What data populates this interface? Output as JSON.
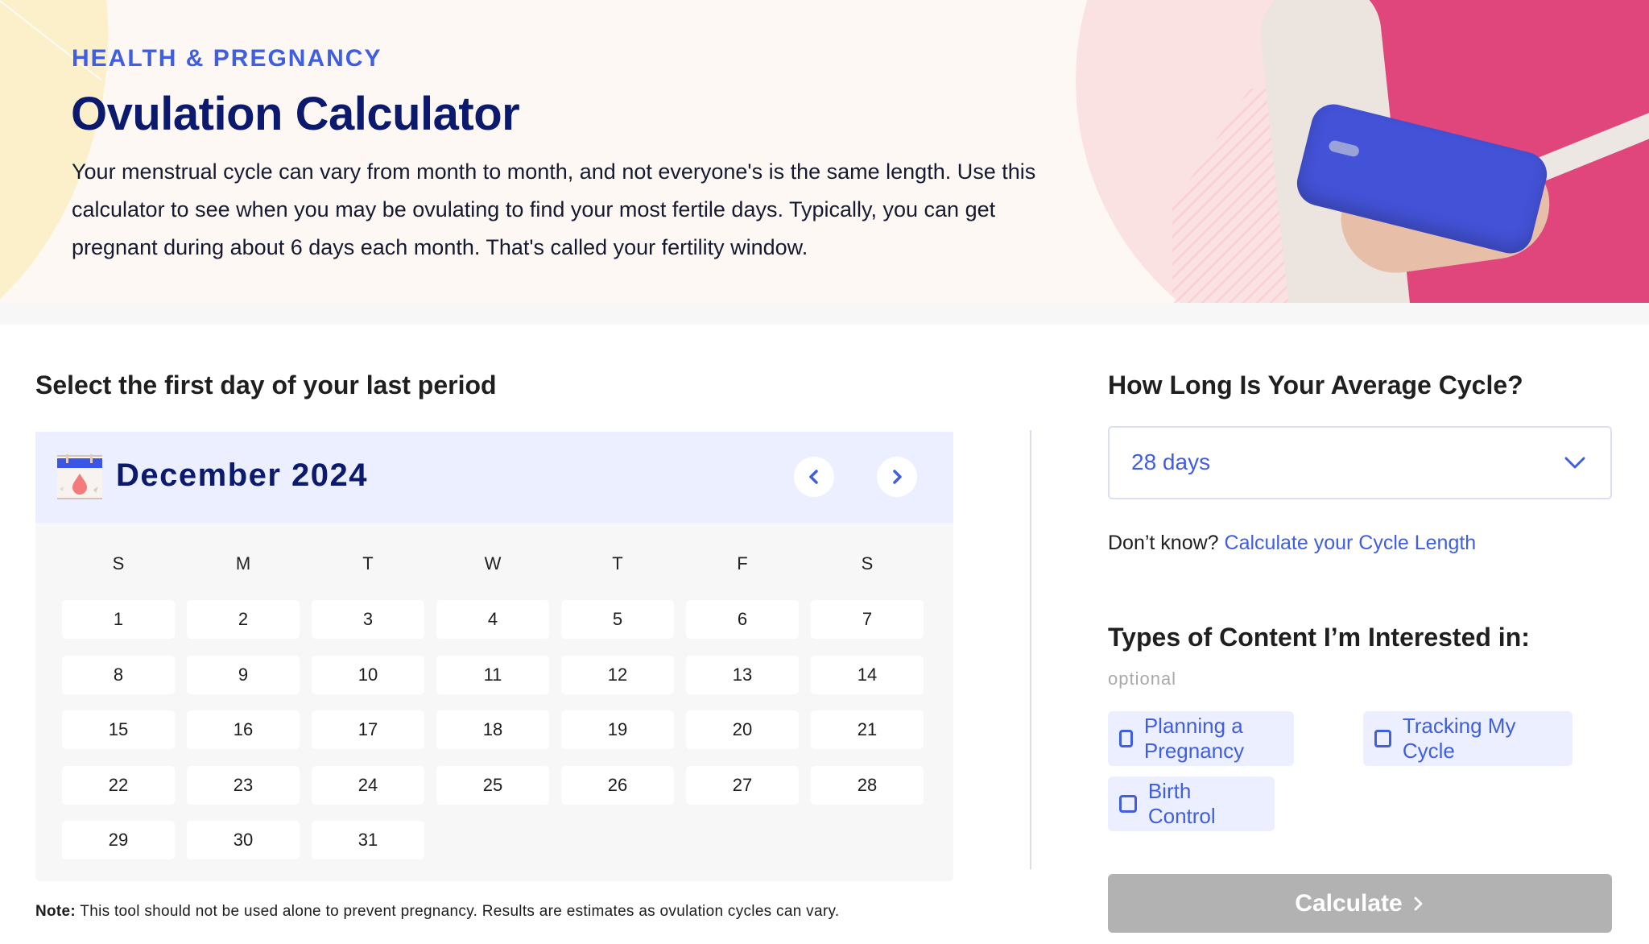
{
  "hero": {
    "eyebrow": "HEALTH & PREGNANCY",
    "title": "Ovulation Calculator",
    "intro": "Your menstrual cycle can vary from month to month, and not everyone's is the same length. Use this calculator to see when you may be ovulating to find your most fertile days. Typically, you can get pregnant during about 6 days each month. That's called your fertility window.",
    "image_description": "hand holding a blue phone against a pink shirt"
  },
  "calendar": {
    "section_title": "Select the first day of your last period",
    "icon": "calendar-blood-drop-icon",
    "month_label": "December 2024",
    "prev_icon": "chevron-left-icon",
    "next_icon": "chevron-right-icon",
    "weekdays": [
      "S",
      "M",
      "T",
      "W",
      "T",
      "F",
      "S"
    ],
    "first_weekday_index": 0,
    "days": [
      "1",
      "2",
      "3",
      "4",
      "5",
      "6",
      "7",
      "8",
      "9",
      "10",
      "11",
      "12",
      "13",
      "14",
      "15",
      "16",
      "17",
      "18",
      "19",
      "20",
      "21",
      "22",
      "23",
      "24",
      "25",
      "26",
      "27",
      "28",
      "29",
      "30",
      "31"
    ],
    "selected_day": null
  },
  "note": {
    "label": "Note:",
    "text": " This tool should not be used alone to prevent pregnancy. Results are estimates as ovulation cycles can vary."
  },
  "cycle": {
    "section_title": "How Long Is Your Average Cycle?",
    "selected_value": "28 days",
    "dropdown_icon": "chevron-down-icon",
    "dont_know_text": "Don’t know? ",
    "dont_know_link": "Calculate your Cycle Length"
  },
  "content_types": {
    "section_title": "Types of Content I’m Interested in:",
    "optional_label": "optional",
    "options": [
      {
        "label": "Planning a Pregnancy",
        "checked": false
      },
      {
        "label": "Tracking My Cycle",
        "checked": false
      },
      {
        "label": "Birth Control",
        "checked": false
      }
    ]
  },
  "calculate": {
    "label": "Calculate",
    "icon": "chevron-right-icon",
    "enabled": false
  },
  "colors": {
    "accent_blue": "#3f5ee0",
    "navy": "#0c1a6e",
    "calendar_header_bg": "#ebefff",
    "calendar_body_bg": "#f7f7f7",
    "disabled_button": "#b2b2b2",
    "hero_bg": "#fdf8f3"
  }
}
